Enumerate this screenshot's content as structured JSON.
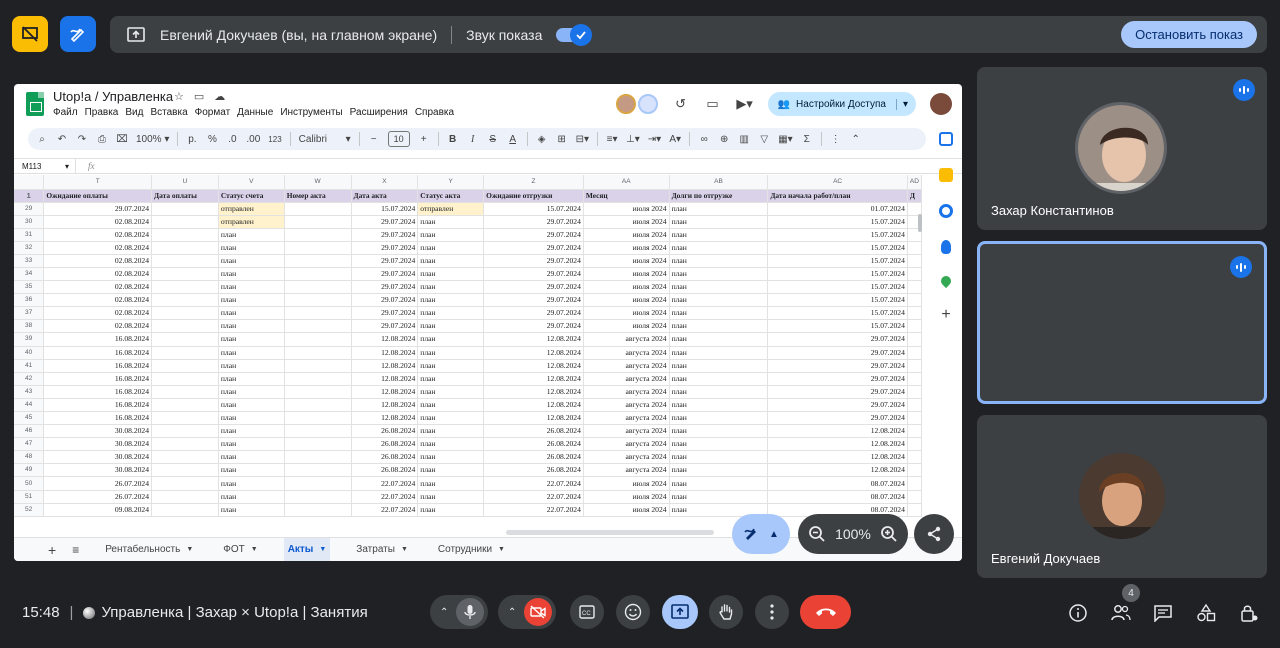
{
  "presenting": {
    "text": "Евгений Докучаев (вы, на главном экране)",
    "sound_label": "Звук показа",
    "stop_label": "Остановить показ"
  },
  "sheet": {
    "title": "Utop!a / Управленка",
    "menu": [
      "Файл",
      "Правка",
      "Вид",
      "Вставка",
      "Формат",
      "Данные",
      "Инструменты",
      "Расширения",
      "Справка"
    ],
    "share_label": "Настройки Доступа",
    "toolbar": {
      "zoom": "100%",
      "currency": "р.",
      "percent": "%",
      "dec_less": ".0",
      "dec_more": ".00",
      "number_format": "123",
      "font": "Calibri",
      "font_size": "10"
    },
    "cell_ref": "M113",
    "fx": "fx",
    "columns": [
      "T",
      "U",
      "V",
      "W",
      "X",
      "Y",
      "Z",
      "AA",
      "AB",
      "AC",
      "AD"
    ],
    "header_row_num": "1",
    "headers": [
      "Ожидание оплаты",
      "Дата оплаты",
      "Статус счета",
      "Номер акта",
      "Дата акта",
      "Статус акта",
      "Ожидание отгрузки",
      "Месяц",
      "Долги по отгрузке",
      "Дата начала работ/план",
      "Д"
    ],
    "rows": [
      {
        "n": "29",
        "t": "29.07.2024",
        "v": "отправлен",
        "x": "15.07.2024",
        "y": "отправлен",
        "z": "15.07.2024",
        "aa": "июля 2024",
        "ab": "план",
        "ac": "01.07.2024"
      },
      {
        "n": "30",
        "t": "02.08.2024",
        "v": "отправлен",
        "x": "29.07.2024",
        "y": "план",
        "z": "29.07.2024",
        "aa": "июля 2024",
        "ab": "план",
        "ac": "15.07.2024"
      },
      {
        "n": "31",
        "t": "02.08.2024",
        "v": "план",
        "x": "29.07.2024",
        "y": "план",
        "z": "29.07.2024",
        "aa": "июля 2024",
        "ab": "план",
        "ac": "15.07.2024"
      },
      {
        "n": "32",
        "t": "02.08.2024",
        "v": "план",
        "x": "29.07.2024",
        "y": "план",
        "z": "29.07.2024",
        "aa": "июля 2024",
        "ab": "план",
        "ac": "15.07.2024"
      },
      {
        "n": "33",
        "t": "02.08.2024",
        "v": "план",
        "x": "29.07.2024",
        "y": "план",
        "z": "29.07.2024",
        "aa": "июля 2024",
        "ab": "план",
        "ac": "15.07.2024"
      },
      {
        "n": "34",
        "t": "02.08.2024",
        "v": "план",
        "x": "29.07.2024",
        "y": "план",
        "z": "29.07.2024",
        "aa": "июля 2024",
        "ab": "план",
        "ac": "15.07.2024"
      },
      {
        "n": "35",
        "t": "02.08.2024",
        "v": "план",
        "x": "29.07.2024",
        "y": "план",
        "z": "29.07.2024",
        "aa": "июля 2024",
        "ab": "план",
        "ac": "15.07.2024"
      },
      {
        "n": "36",
        "t": "02.08.2024",
        "v": "план",
        "x": "29.07.2024",
        "y": "план",
        "z": "29.07.2024",
        "aa": "июля 2024",
        "ab": "план",
        "ac": "15.07.2024"
      },
      {
        "n": "37",
        "t": "02.08.2024",
        "v": "план",
        "x": "29.07.2024",
        "y": "план",
        "z": "29.07.2024",
        "aa": "июля 2024",
        "ab": "план",
        "ac": "15.07.2024"
      },
      {
        "n": "38",
        "t": "02.08.2024",
        "v": "план",
        "x": "29.07.2024",
        "y": "план",
        "z": "29.07.2024",
        "aa": "июля 2024",
        "ab": "план",
        "ac": "15.07.2024"
      },
      {
        "n": "39",
        "t": "16.08.2024",
        "v": "план",
        "x": "12.08.2024",
        "y": "план",
        "z": "12.08.2024",
        "aa": "августа 2024",
        "ab": "план",
        "ac": "29.07.2024"
      },
      {
        "n": "40",
        "t": "16.08.2024",
        "v": "план",
        "x": "12.08.2024",
        "y": "план",
        "z": "12.08.2024",
        "aa": "августа 2024",
        "ab": "план",
        "ac": "29.07.2024"
      },
      {
        "n": "41",
        "t": "16.08.2024",
        "v": "план",
        "x": "12.08.2024",
        "y": "план",
        "z": "12.08.2024",
        "aa": "августа 2024",
        "ab": "план",
        "ac": "29.07.2024"
      },
      {
        "n": "42",
        "t": "16.08.2024",
        "v": "план",
        "x": "12.08.2024",
        "y": "план",
        "z": "12.08.2024",
        "aa": "августа 2024",
        "ab": "план",
        "ac": "29.07.2024"
      },
      {
        "n": "43",
        "t": "16.08.2024",
        "v": "план",
        "x": "12.08.2024",
        "y": "план",
        "z": "12.08.2024",
        "aa": "августа 2024",
        "ab": "план",
        "ac": "29.07.2024"
      },
      {
        "n": "44",
        "t": "16.08.2024",
        "v": "план",
        "x": "12.08.2024",
        "y": "план",
        "z": "12.08.2024",
        "aa": "августа 2024",
        "ab": "план",
        "ac": "29.07.2024"
      },
      {
        "n": "45",
        "t": "16.08.2024",
        "v": "план",
        "x": "12.08.2024",
        "y": "план",
        "z": "12.08.2024",
        "aa": "августа 2024",
        "ab": "план",
        "ac": "29.07.2024"
      },
      {
        "n": "46",
        "t": "30.08.2024",
        "v": "план",
        "x": "26.08.2024",
        "y": "план",
        "z": "26.08.2024",
        "aa": "августа 2024",
        "ab": "план",
        "ac": "12.08.2024"
      },
      {
        "n": "47",
        "t": "30.08.2024",
        "v": "план",
        "x": "26.08.2024",
        "y": "план",
        "z": "26.08.2024",
        "aa": "августа 2024",
        "ab": "план",
        "ac": "12.08.2024"
      },
      {
        "n": "48",
        "t": "30.08.2024",
        "v": "план",
        "x": "26.08.2024",
        "y": "план",
        "z": "26.08.2024",
        "aa": "августа 2024",
        "ab": "план",
        "ac": "12.08.2024"
      },
      {
        "n": "49",
        "t": "30.08.2024",
        "v": "план",
        "x": "26.08.2024",
        "y": "план",
        "z": "26.08.2024",
        "aa": "августа 2024",
        "ab": "план",
        "ac": "12.08.2024"
      },
      {
        "n": "50",
        "t": "26.07.2024",
        "v": "план",
        "x": "22.07.2024",
        "y": "план",
        "z": "22.07.2024",
        "aa": "июля 2024",
        "ab": "план",
        "ac": "08.07.2024"
      },
      {
        "n": "51",
        "t": "26.07.2024",
        "v": "план",
        "x": "22.07.2024",
        "y": "план",
        "z": "22.07.2024",
        "aa": "июля 2024",
        "ab": "план",
        "ac": "08.07.2024"
      },
      {
        "n": "52",
        "t": "09.08.2024",
        "v": "план",
        "x": "22.07.2024",
        "y": "план",
        "z": "22.07.2024",
        "aa": "июля 2024",
        "ab": "план",
        "ac": "08.07.2024"
      }
    ],
    "tabs": [
      {
        "label": "Рентабельность",
        "active": false
      },
      {
        "label": "ФОТ",
        "active": false
      },
      {
        "label": "Акты",
        "active": true
      },
      {
        "label": "Затраты",
        "active": false
      },
      {
        "label": "Сотрудники",
        "active": false
      }
    ]
  },
  "zoom_control": {
    "value": "100%"
  },
  "participants": [
    {
      "name": "Захар Константинов"
    },
    {
      "name": "Евгений Докучаев"
    }
  ],
  "meeting": {
    "time": "15:48",
    "title": "Управленка | Захар × Utop!a | Занятия",
    "participant_count": "4"
  },
  "colors": {
    "background": "#202124",
    "tile": "#3c4043",
    "accent": "#8ab4f8",
    "primary_blue": "#1a73e8",
    "end_call_red": "#ea4335",
    "header_purple": "#d9d2e9",
    "highlight_yellow": "#fff2cc"
  }
}
